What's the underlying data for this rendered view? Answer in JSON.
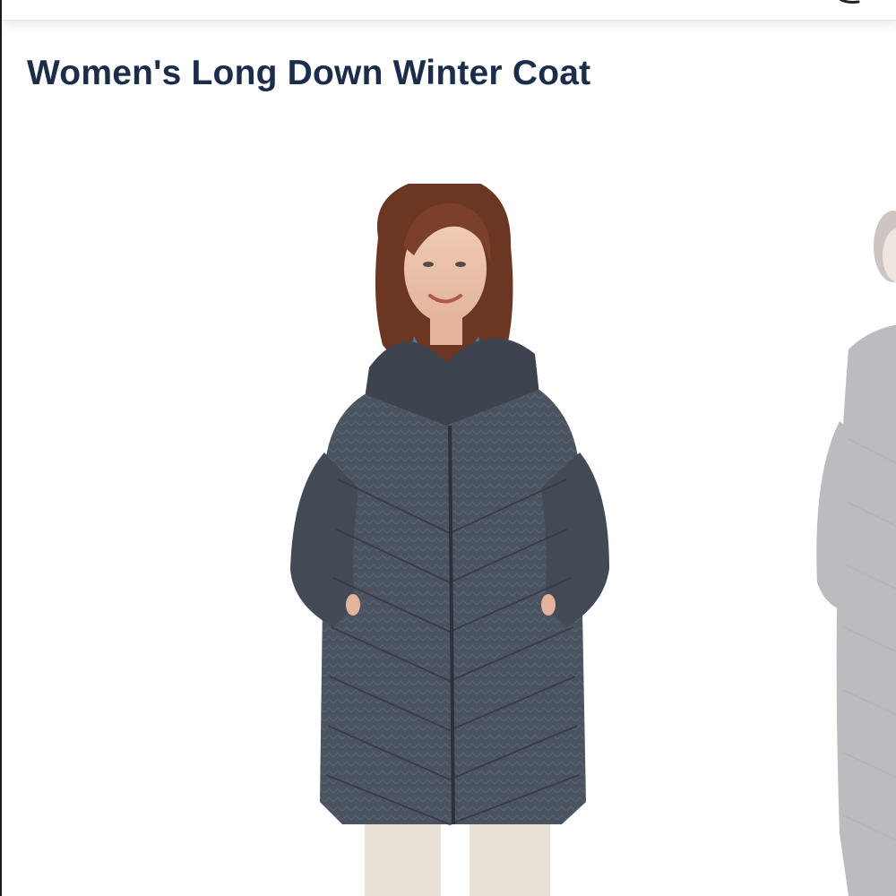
{
  "product": {
    "title": "Women's Long Down Winter Coat"
  },
  "carousel": {
    "main_image_alt": "Model wearing a long quilted down winter coat with hood",
    "next_image_alt": "Next product image preview"
  },
  "colors": {
    "title_text": "#1b2d4a",
    "coat": "#47505d",
    "background": "#ffffff"
  },
  "icons": {
    "top_bar_edge": "partial-icon"
  }
}
